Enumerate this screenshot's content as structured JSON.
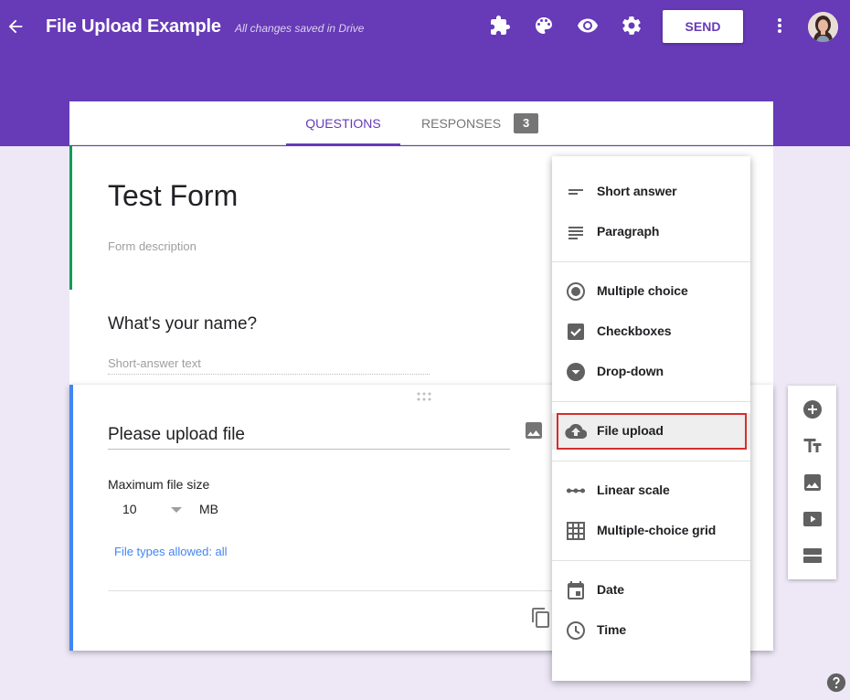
{
  "header": {
    "title": "File Upload Example",
    "save_status": "All changes saved in Drive",
    "send_label": "SEND",
    "icons": [
      "back-arrow-icon",
      "addons-icon",
      "palette-icon",
      "preview-eye-icon",
      "settings-gear-icon",
      "more-vert-icon",
      "avatar"
    ],
    "brand_color": "#673ab7"
  },
  "tabs": {
    "questions_label": "QUESTIONS",
    "responses_label": "RESPONSES",
    "responses_count": "3"
  },
  "form": {
    "title": "Test Form",
    "description_placeholder": "Form description"
  },
  "question1": {
    "title": "What's your name?",
    "hint": "Short-answer text"
  },
  "question2": {
    "title": "Please upload file",
    "max_size_label": "Maximum file size",
    "max_size_value": "10",
    "max_size_unit": "MB",
    "file_types_link": "File types allowed: all"
  },
  "type_menu": {
    "items": [
      {
        "label": "Short answer",
        "icon": "short-answer-icon"
      },
      {
        "label": "Paragraph",
        "icon": "paragraph-icon"
      },
      {
        "label": "Multiple choice",
        "icon": "radio-icon"
      },
      {
        "label": "Checkboxes",
        "icon": "checkbox-icon"
      },
      {
        "label": "Drop-down",
        "icon": "dropdown-icon"
      },
      {
        "label": "File upload",
        "icon": "cloud-upload-icon",
        "selected": true
      },
      {
        "label": "Linear scale",
        "icon": "linear-scale-icon"
      },
      {
        "label": "Multiple-choice grid",
        "icon": "grid-icon"
      },
      {
        "label": "Date",
        "icon": "calendar-icon"
      },
      {
        "label": "Time",
        "icon": "clock-icon"
      }
    ],
    "highlight_color": "#d32f2f"
  },
  "side_toolbar": {
    "icons": [
      "add-question-icon",
      "add-title-icon",
      "add-image-icon",
      "add-video-icon",
      "add-section-icon"
    ]
  }
}
